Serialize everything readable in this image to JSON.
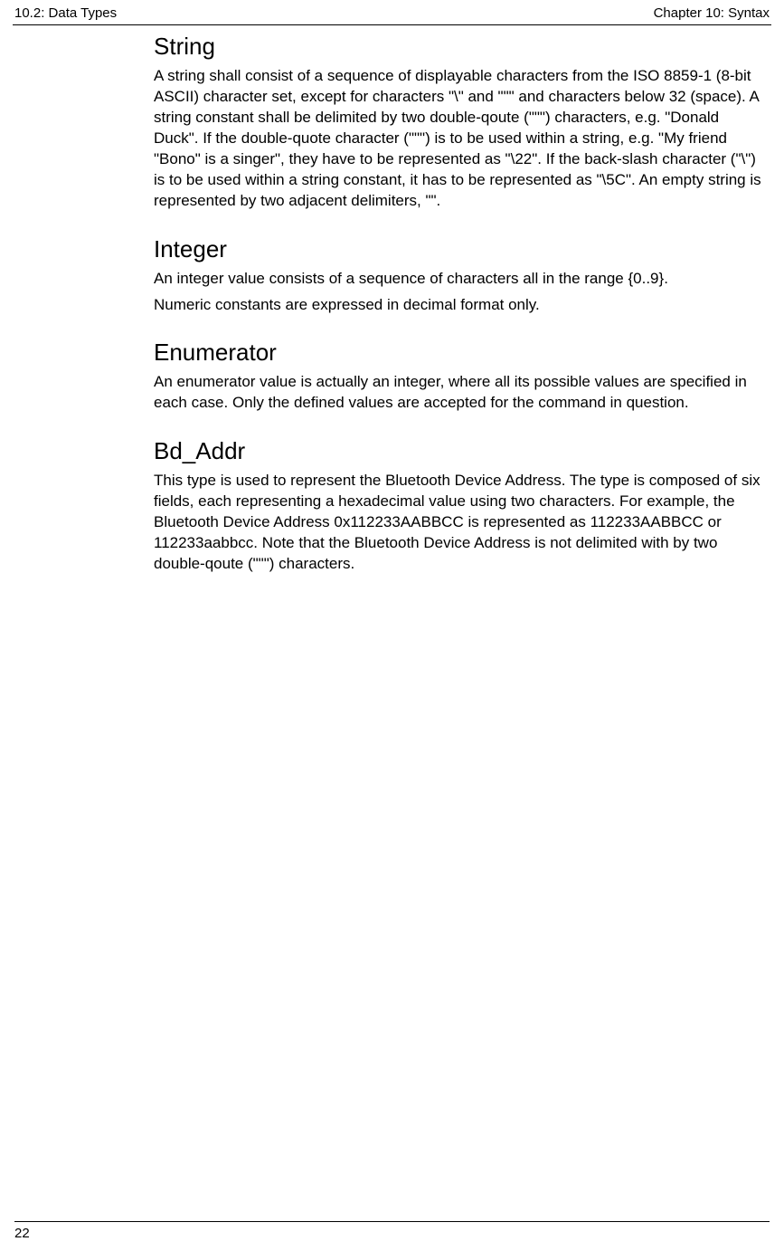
{
  "header": {
    "left": "10.2: Data Types",
    "right": "Chapter 10: Syntax"
  },
  "sections": {
    "string": {
      "heading": "String",
      "body": "A string shall consist of a sequence of displayable characters from the ISO 8859-1 (8-bit ASCII) character set, except for characters \"\\\" and \"\"\" and characters below 32 (space). A string constant shall be delimited by two double-qoute (\"\"\") characters, e.g. \"Donald Duck\". If the double-quote character (\"\"\") is to be used within a string, e.g. \"My friend \"Bono\" is a singer\", they have to be represented as \"\\22\". If the back-slash character (\"\\\") is to be used within a string constant, it has to be represented as \"\\5C\". An empty string is represented by two adjacent delimiters, \"\"."
    },
    "integer": {
      "heading": "Integer",
      "body1": "An integer value consists of a sequence of characters all in the range {0..9}.",
      "body2": "Numeric constants are expressed in decimal format only."
    },
    "enumerator": {
      "heading": "Enumerator",
      "body": "An enumerator value is actually an integer, where all its possible values are specified in each case. Only the defined values are accepted for the command in question."
    },
    "bdaddr": {
      "heading": "Bd_Addr",
      "body_pre": "This type is used to represent the Bluetooth Device Address. The type is composed of six fields, each representing a hexadecimal value using two characters. For example, the Bluetooth Device Address 0x112233AABBCC is represented as 112233AABBCC or 112233aabbcc. Note that the Bluetooth Device Address is ",
      "body_bold": "not",
      "body_post": " delimited with by two double-qoute (\"\"\") characters."
    }
  },
  "footer": {
    "page": "22"
  }
}
